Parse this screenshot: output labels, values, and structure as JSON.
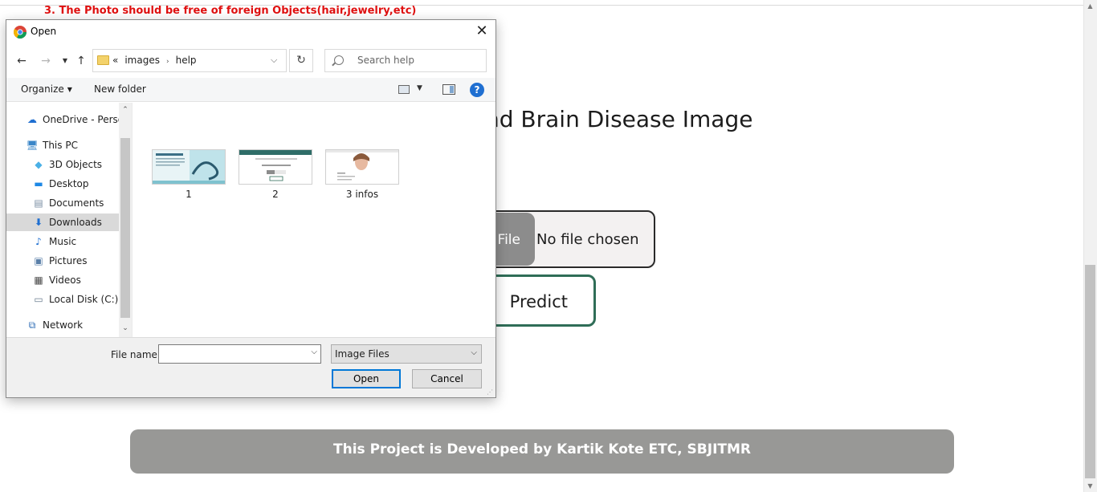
{
  "page": {
    "notice": "3. The Photo should be free of foreign Objects(hair,jewelry,etc)",
    "heading": "nd Brain Disease Image",
    "file_button": "File",
    "file_status": "No file chosen",
    "predict_button": "Predict",
    "footer": "This Project is Developed by Kartik Kote ETC, SBJITMR"
  },
  "dialog": {
    "title": "Open",
    "close_glyph": "✕",
    "address": {
      "chevrons": "«",
      "path": [
        "images",
        "help"
      ]
    },
    "search_placeholder": "Search help",
    "toolbar": {
      "organize": "Organize",
      "new_folder": "New folder"
    },
    "tree": [
      {
        "label": "OneDrive - Person",
        "icon": "cloud-icon",
        "color": "#1f6fd1"
      },
      {
        "label": "This PC",
        "icon": "computer-icon",
        "color": "#3a86c8"
      },
      {
        "label": "3D Objects",
        "icon": "cube-icon",
        "color": "#4ab0e6"
      },
      {
        "label": "Desktop",
        "icon": "desktop-icon",
        "color": "#1e88e5"
      },
      {
        "label": "Documents",
        "icon": "document-icon",
        "color": "#7a8ea3"
      },
      {
        "label": "Downloads",
        "icon": "download-icon",
        "color": "#1f6fd1"
      },
      {
        "label": "Music",
        "icon": "music-icon",
        "color": "#1f6fd1"
      },
      {
        "label": "Pictures",
        "icon": "pictures-icon",
        "color": "#5a7fa8"
      },
      {
        "label": "Videos",
        "icon": "video-icon",
        "color": "#4a4a4a"
      },
      {
        "label": "Local Disk (C:)",
        "icon": "disk-icon",
        "color": "#6a7c8e"
      },
      {
        "label": "Network",
        "icon": "network-icon",
        "color": "#2d6cb5"
      }
    ],
    "selected_item": "Downloads",
    "files": [
      {
        "label": "1"
      },
      {
        "label": "2"
      },
      {
        "label": "3 infos"
      }
    ],
    "file_name_label": "File name:",
    "file_name_value": "",
    "file_type": "Image Files",
    "open_button": "Open",
    "cancel_button": "Cancel"
  }
}
